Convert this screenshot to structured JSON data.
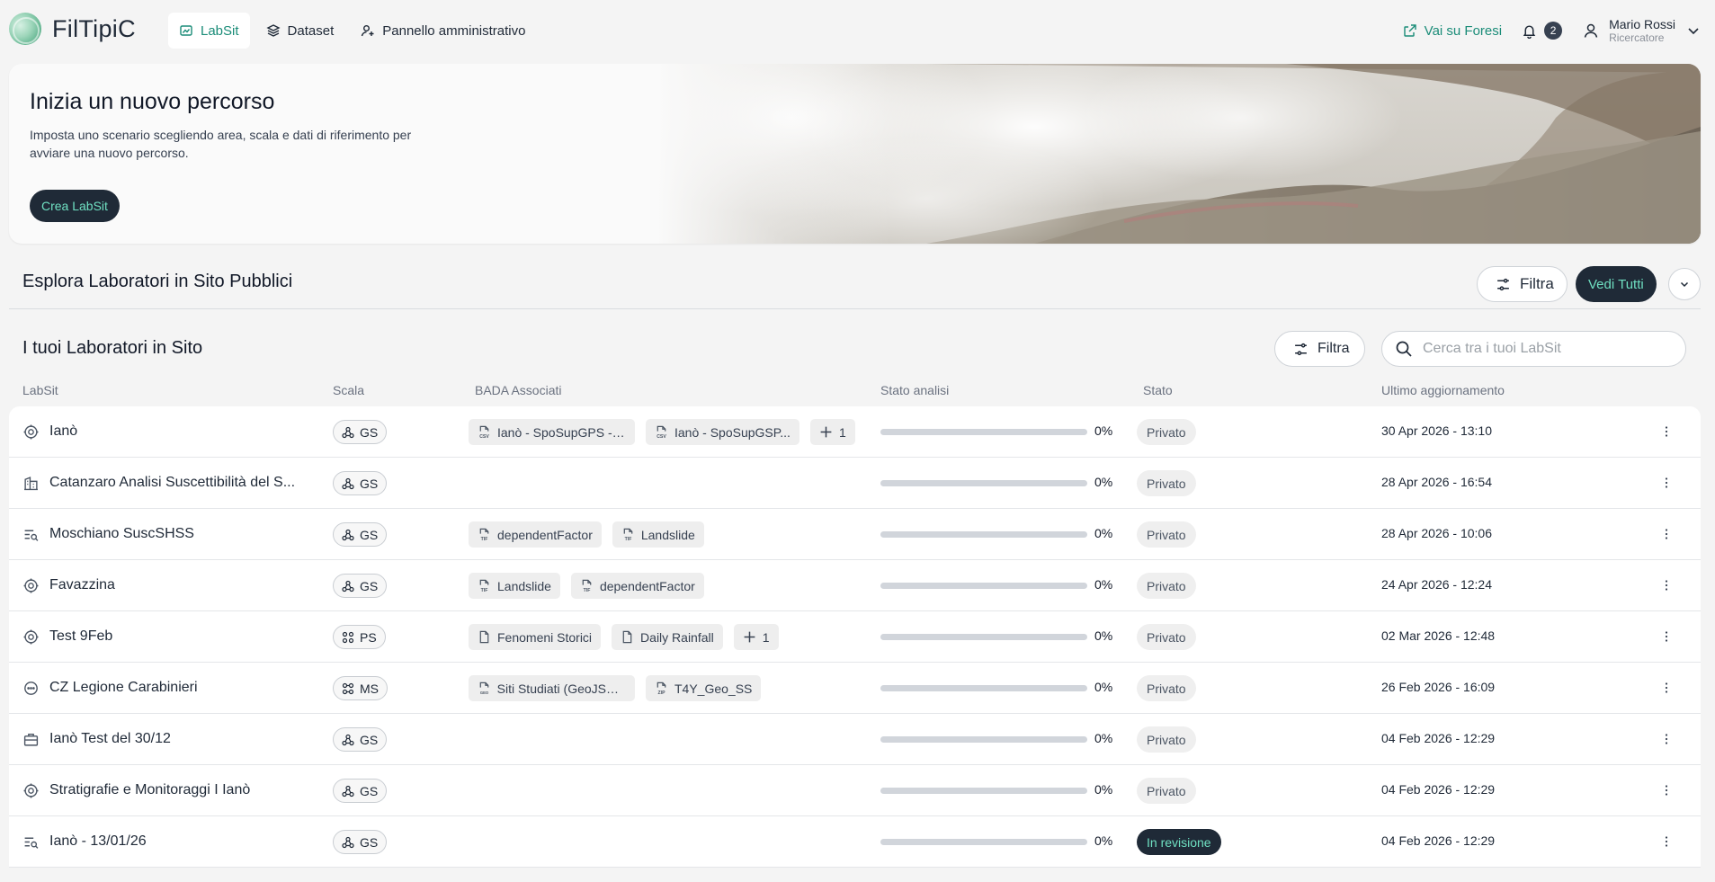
{
  "app": {
    "name": "FilTipiC"
  },
  "nav": [
    {
      "label": "LabSit",
      "icon": "labsit-icon",
      "active": true
    },
    {
      "label": "Dataset",
      "icon": "layers-icon",
      "active": false
    },
    {
      "label": "Pannello amministrativo",
      "icon": "user-admin-icon",
      "active": false
    }
  ],
  "header": {
    "external_link": "Vai su Foresi",
    "notifications_count": "2",
    "user_name": "Mario Rossi",
    "user_role": "Ricercatore"
  },
  "hero": {
    "title": "Inizia un nuovo percorso",
    "description": "Imposta uno scenario scegliendo area, scala e dati di riferimento per avviare una nuovo percorso.",
    "cta": "Crea LabSit"
  },
  "explore": {
    "title": "Esplora Laboratori in Sito Pubblici",
    "filter": "Filtra",
    "see_all": "Vedi Tutti"
  },
  "my_labs": {
    "title": "I tuoi Laboratori in Sito",
    "filter": "Filtra",
    "search_placeholder": "Cerca tra i tuoi LabSit",
    "columns": {
      "labsit": "LabSit",
      "scale": "Scala",
      "bada": "BADA Associati",
      "analysis": "Stato analisi",
      "status": "Stato",
      "updated": "Ultimo aggiornamento"
    },
    "rows": [
      {
        "icon": "target-icon",
        "name": "Ianò",
        "scale": "GS",
        "chips": [
          {
            "icon": "csv-file-icon",
            "label": "Ianò - SpoSupGPS - ..."
          },
          {
            "icon": "csv-file-icon",
            "label": "Ianò - SpoSupGSP..."
          }
        ],
        "more": "1",
        "progress": "0%",
        "progress_value": 0,
        "status": "Privato",
        "review": false,
        "date": "30 Apr 2026 - 13:10"
      },
      {
        "icon": "building-icon",
        "name": "Catanzaro Analisi Suscettibilità del S...",
        "scale": "GS",
        "chips": [],
        "more": "",
        "progress": "0%",
        "progress_value": 0,
        "status": "Privato",
        "review": false,
        "date": "28 Apr 2026 - 16:54"
      },
      {
        "icon": "list-search-icon",
        "name": "Moschiano SuscSHSS",
        "scale": "GS",
        "chips": [
          {
            "icon": "tif-file-icon",
            "label": "dependentFactor"
          },
          {
            "icon": "tif-file-icon",
            "label": "Landslide"
          }
        ],
        "more": "",
        "progress": "0%",
        "progress_value": 0,
        "status": "Privato",
        "review": false,
        "date": "28 Apr 2026 - 10:06"
      },
      {
        "icon": "target-icon",
        "name": "Favazzina",
        "scale": "GS",
        "chips": [
          {
            "icon": "tif-file-icon",
            "label": "Landslide"
          },
          {
            "icon": "tif-file-icon",
            "label": "dependentFactor"
          }
        ],
        "more": "",
        "progress": "0%",
        "progress_value": 0,
        "status": "Privato",
        "review": false,
        "date": "24 Apr 2026 - 12:24"
      },
      {
        "icon": "target-icon",
        "name": "Test 9Feb",
        "scale": "PS",
        "chips": [
          {
            "icon": "file-icon",
            "label": "Fenomeni Storici"
          },
          {
            "icon": "file-icon",
            "label": "Daily Rainfall"
          }
        ],
        "more": "1",
        "progress": "0%",
        "progress_value": 0,
        "status": "Privato",
        "review": false,
        "date": "02 Mar 2026 - 12:48"
      },
      {
        "icon": "chat-icon",
        "name": "CZ Legione Carabinieri",
        "scale": "MS",
        "chips": [
          {
            "icon": "geojson-file-icon",
            "label": "Siti Studiati (GeoJSON)"
          },
          {
            "icon": "zip-file-icon",
            "label": "T4Y_Geo_SS"
          }
        ],
        "more": "",
        "progress": "0%",
        "progress_value": 0,
        "status": "Privato",
        "review": false,
        "date": "26 Feb 2026 - 16:09"
      },
      {
        "icon": "briefcase-icon",
        "name": "Ianò Test del 30/12",
        "scale": "GS",
        "chips": [],
        "more": "",
        "progress": "0%",
        "progress_value": 0,
        "status": "Privato",
        "review": false,
        "date": "04 Feb 2026 - 12:29"
      },
      {
        "icon": "target-icon",
        "name": "Stratigrafie e Monitoraggi I Ianò",
        "scale": "GS",
        "chips": [],
        "more": "",
        "progress": "0%",
        "progress_value": 0,
        "status": "Privato",
        "review": false,
        "date": "04 Feb 2026 - 12:29"
      },
      {
        "icon": "list-search-icon",
        "name": "Ianò - 13/01/26",
        "scale": "GS",
        "chips": [],
        "more": "",
        "progress": "0%",
        "progress_value": 0,
        "status": "In revisione",
        "review": true,
        "date": "04 Feb 2026 - 12:29"
      }
    ]
  },
  "colors": {
    "accent": "#1a8c78",
    "dark": "#1f2a37",
    "mint": "#6fe0c2"
  }
}
